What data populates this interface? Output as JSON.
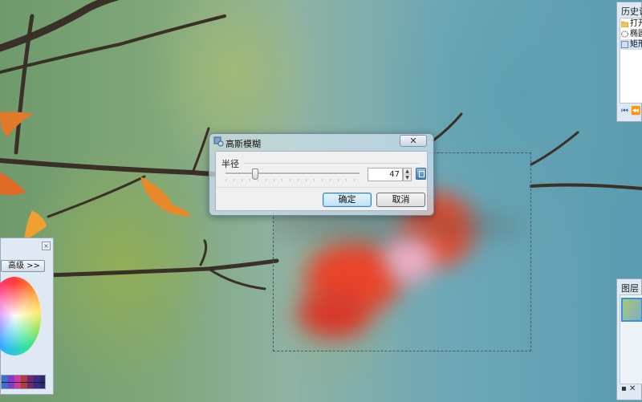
{
  "dialog": {
    "title": "高斯模糊",
    "close": "✕",
    "group_label": "半径",
    "radius_value": "47",
    "radius_fraction": 0.22,
    "ok": "确定",
    "cancel": "取消"
  },
  "history_panel": {
    "title": "历史记",
    "items": [
      {
        "label": "打开",
        "icon": "folder-icon"
      },
      {
        "label": "椭圆",
        "icon": "ellipse-select-icon"
      },
      {
        "label": "矩形",
        "icon": "rect-select-icon"
      }
    ],
    "footer": "⏮ ⏪"
  },
  "layers_panel": {
    "title": "图层",
    "footer": "▪ ✕"
  },
  "color_panel": {
    "close": "×",
    "advanced_label": "高级 >>"
  },
  "colors": {
    "accent": "#3a8ee6",
    "dialog_frame": "#6d8aa5"
  }
}
